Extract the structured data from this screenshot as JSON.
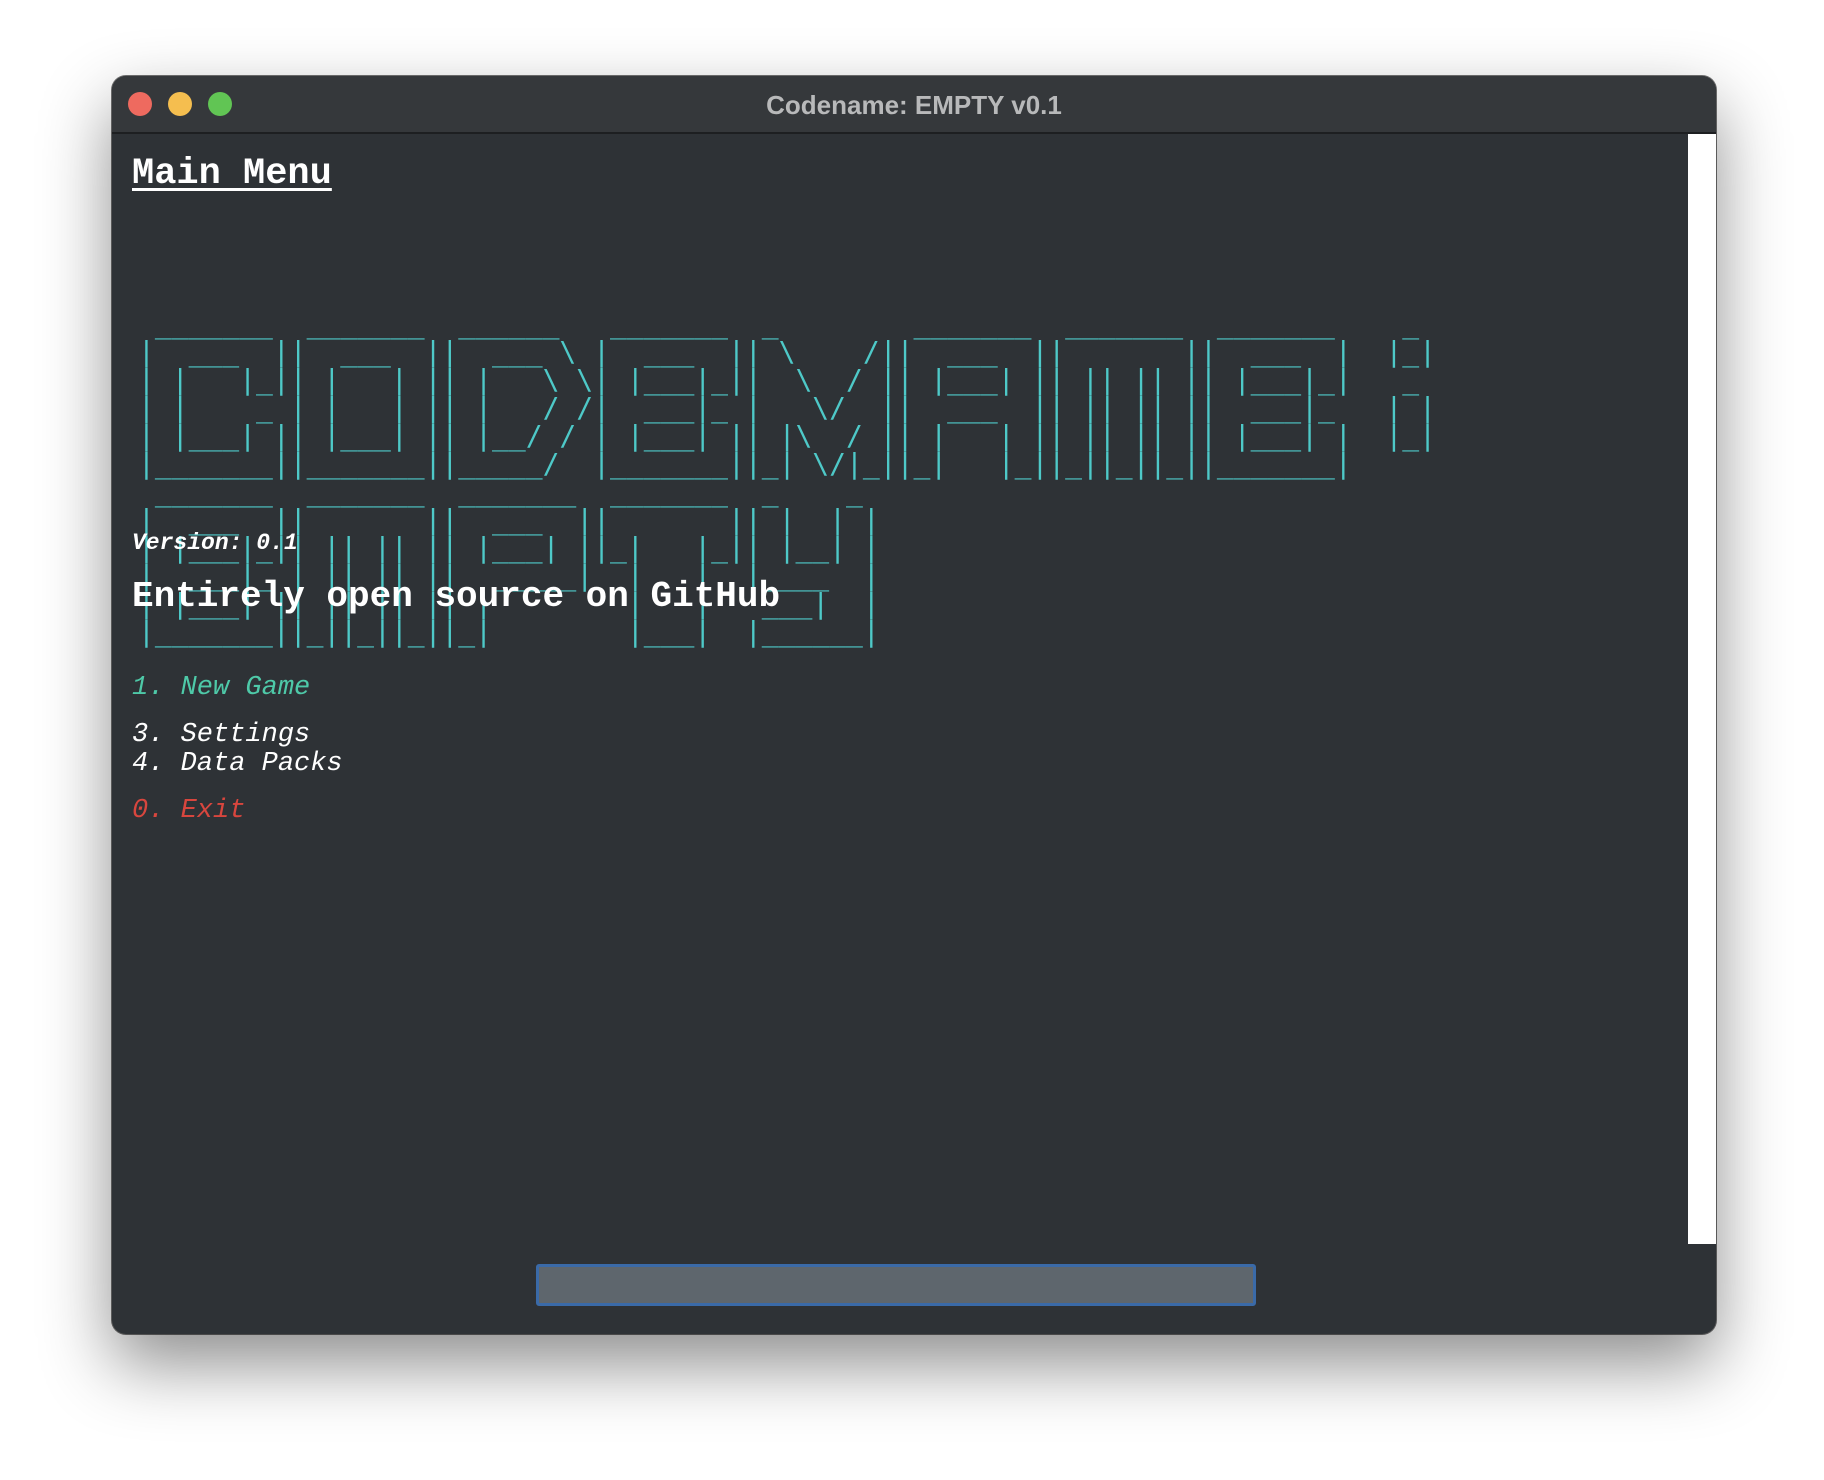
{
  "window": {
    "title": "Codename: EMPTY v0.1",
    "buttons": {
      "close_color": "#ee6a5f",
      "minimize_color": "#f5be4f",
      "maximize_color": "#61c554"
    }
  },
  "main": {
    "heading": "Main Menu",
    "logo_ascii": " _______  _______  ______   _______  _        _______  _______  _______    _ \n|  ___  ||  ___  ||  ___ \\ |  ___  || \\    /||  ___  ||       ||  ___  |  |_|\n| |   |_|| |   | || |   \\ \\| |___|_||  \\  / || |___| || || || || |___|_|   _ \n| |    _ | |   | || |   / /|  ___|_ |   \\/  ||  ___  || || || ||  ___|_   | |\n| |___| || |___| || |__/ / | |___| || |\\  / || |   | || || || || |___| |  |_|\n|_______||_______||_____/  |_______||_| \\/|_||_|   |_||_||_||_||_______|     \n _______  _______  _______  _______  _    _ \n|  ___  ||       ||  ___  ||       || |  | |\n| |___|_|| || || || |___| ||_|   |_|| |__| |\n|  ___|_ | || || ||  _____|  |   |  |____  |\n| |___| || || || || |        |   |   ___|  |\n|_______||_||_||_||_|        |___|  |______|",
    "version": "Version: 0.1",
    "tagline": "Entirely open source on GitHub",
    "menu": [
      {
        "label": "1. New Game",
        "color": "#4ec9a8"
      },
      {
        "label": "3. Settings",
        "color": "#ffffff"
      },
      {
        "label": "4. Data Packs",
        "color": "#ffffff"
      },
      {
        "label": "0. Exit",
        "color": "#d8463e"
      }
    ]
  },
  "command_input": {
    "value": "",
    "placeholder": ""
  },
  "colors": {
    "background": "#2e3236",
    "ascii": "#4ec9c8"
  }
}
